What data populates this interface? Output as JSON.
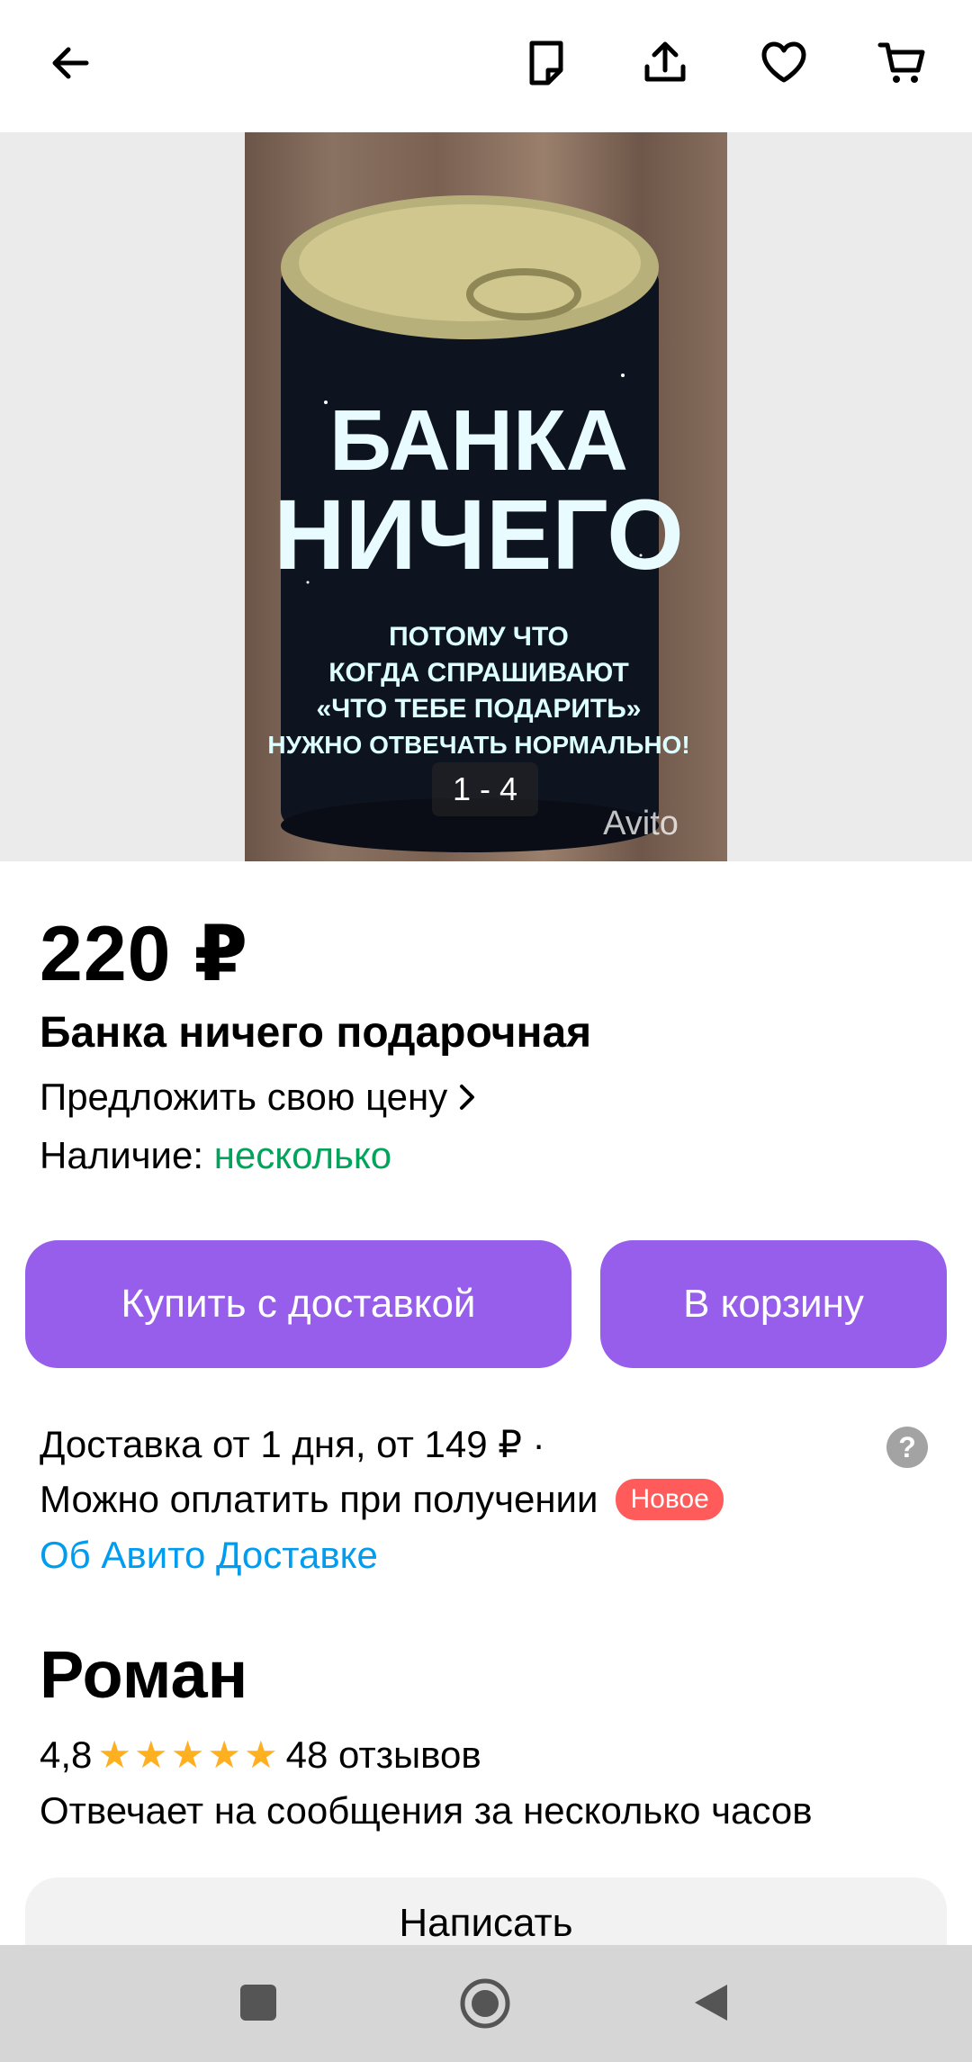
{
  "icons": {
    "back": "arrow-left-icon",
    "notes": "note-icon",
    "share": "share-icon",
    "favorite": "heart-icon",
    "cart": "cart-icon"
  },
  "gallery": {
    "counter": "1 - 4",
    "product_image": {
      "can_text_line1": "БАНКА",
      "can_text_line2": "НИЧЕГО",
      "can_text_small": [
        "ПОТОМУ ЧТО",
        "КОГДА СПРАШИВАЮТ",
        "«ЧТО ТЕБЕ ПОДАРИТЬ»",
        "НУЖНО ОТВЕЧАТЬ НОРМАЛЬНО!"
      ],
      "watermark": "Avito"
    }
  },
  "product": {
    "price": "220 ₽",
    "title": "Банка ничего подарочная",
    "offer_price_label": "Предложить свою цену",
    "availability_label": "Наличие:",
    "availability_value": "несколько"
  },
  "actions": {
    "buy_with_delivery": "Купить с доставкой",
    "add_to_cart": "В корзину"
  },
  "delivery": {
    "line1": "Доставка  от 1 дня, от 149 ₽ ·",
    "line2": "Можно оплатить при получении",
    "badge_new": "Новое",
    "link": "Об Авито Доставке",
    "help": "?"
  },
  "seller": {
    "name": "Роман",
    "rating": "4,8",
    "stars": 5,
    "reviews": "48 отзывов",
    "reply_time": "Отвечает на сообщения за несколько часов",
    "write_button": "Написать"
  },
  "colors": {
    "accent": "#965eeb",
    "availability": "#02a35b",
    "link": "#009cf0",
    "badge": "#ff5b5b",
    "star": "#ffb021"
  }
}
